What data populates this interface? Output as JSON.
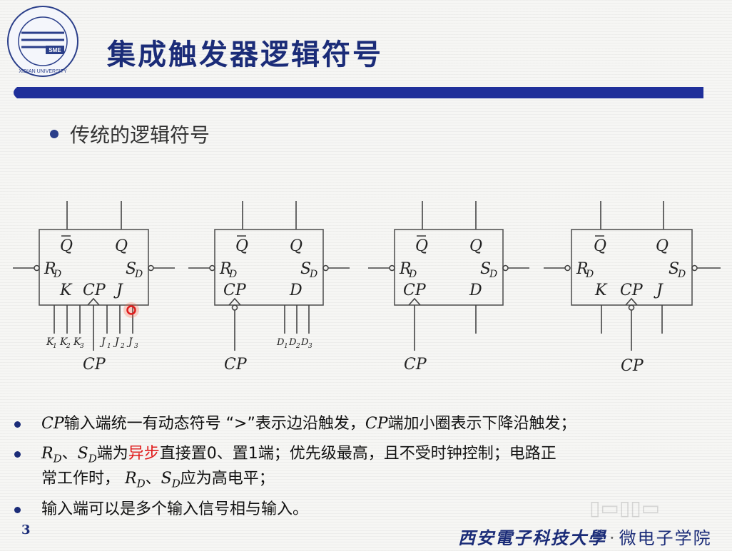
{
  "header": {
    "title": "集成触发器逻辑符号",
    "logo_text": "SME",
    "logo_ring": "XIDIAN UNIVERSITY"
  },
  "subtitle": "传统的逻辑符号",
  "circuits": {
    "qbar": "Q",
    "q": "Q",
    "rd_main": "R",
    "rd_sub": "D",
    "sd_main": "S",
    "sd_sub": "D",
    "k": "K",
    "j": "J",
    "cp": "CP",
    "d": "D",
    "cp_bottom": "CP",
    "k_inputs": [
      {
        "m": "K",
        "s": "1"
      },
      {
        "m": "K",
        "s": "2"
      },
      {
        "m": "K",
        "s": "3"
      }
    ],
    "j_inputs": [
      {
        "m": "J",
        "s": "1"
      },
      {
        "m": "J",
        "s": "2"
      },
      {
        "m": "J",
        "s": "3"
      }
    ],
    "d_inputs": [
      {
        "m": "D",
        "s": "1"
      },
      {
        "m": "D",
        "s": "2"
      },
      {
        "m": "D",
        "s": "3"
      }
    ]
  },
  "bullets": {
    "b1": {
      "cp1": "CP",
      "t1": "输入端统一有动态符号 “>”表示边沿触发，",
      "cp2": "CP",
      "t2": "端加小圈表示下降沿触发；"
    },
    "b2": {
      "r": "R",
      "rs": "D",
      "sep": "、",
      "s": "S",
      "ss": "D",
      "t1": "端为",
      "red": "异步",
      "t2": "直接置0、置1端；优先级最高，且不受时钟控制；电路正"
    },
    "b2b": {
      "t1": "常工作时，",
      "r": "R",
      "rs": "D",
      "sep": "、",
      "s": "S",
      "ss": "D",
      "t2": "应为高电平；"
    },
    "b3": "输入端可以是多个输入信号相与输入。"
  },
  "page_number": "3",
  "footer": {
    "school": "西安電子科技大學",
    "sep": "·",
    "dept": "微电子学院"
  },
  "colors": {
    "title": "#1b2c78",
    "bar": "#1f2f9a",
    "highlight_red": "#e01b1b"
  }
}
